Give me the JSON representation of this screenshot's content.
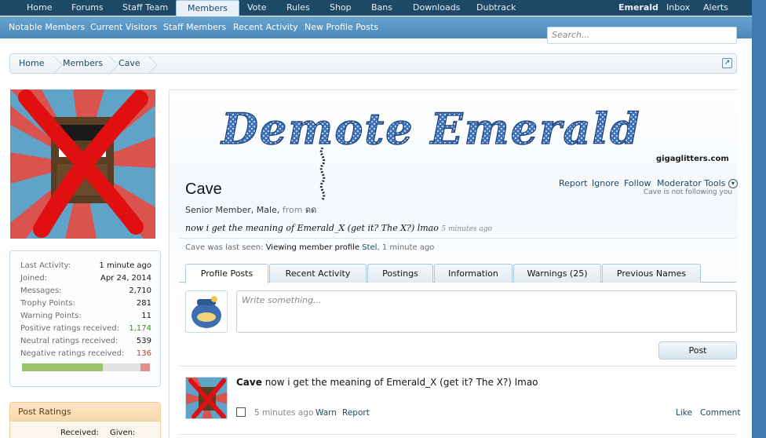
{
  "nav": {
    "items": [
      "Home",
      "Forums",
      "Staff Team",
      "Members",
      "Vote",
      "Rules",
      "Shop",
      "Bans",
      "Downloads",
      "Dubtrack"
    ],
    "active": "Members",
    "user": [
      "Emerald",
      "Inbox",
      "Alerts"
    ]
  },
  "subnav": [
    "Notable Members",
    "Current Visitors",
    "Staff Members",
    "Recent Activity",
    "New Profile Posts"
  ],
  "search": {
    "placeholder": "Search..."
  },
  "breadcrumb": [
    "Home",
    "Members",
    "Cave"
  ],
  "banner": {
    "text": "Demote Emerald",
    "credit": "gigaglitters.com"
  },
  "profile": {
    "name": "Cave",
    "meta_prefix": "Senior Member, Male, ",
    "from_label": "from",
    "from_value": "ดด",
    "status": "now i get the meaning of Emerald_X (get it? The X?) lmao",
    "status_ago": "5 minutes ago",
    "last_seen_prefix": "Cave was last seen:",
    "last_seen_action": "Viewing member profile",
    "last_seen_member": "Stel",
    "last_seen_time": ", 1 minute ago",
    "actions": [
      "Report",
      "Ignore",
      "Follow",
      "Moderator Tools"
    ],
    "follow_note": "Cave is not following you"
  },
  "stats": [
    {
      "k": "Last Activity:",
      "v": "1 minute ago",
      "color": "#141414"
    },
    {
      "k": "Joined:",
      "v": "Apr 24, 2014",
      "color": "#141414"
    },
    {
      "k": "Messages:",
      "v": "2,710",
      "color": "#141414"
    },
    {
      "k": "Trophy Points:",
      "v": "281",
      "color": "#141414"
    },
    {
      "k": "Warning Points:",
      "v": "11",
      "color": "#141414"
    },
    {
      "k": "Positive ratings received:",
      "v": "1,174",
      "color": "#3f8f1f"
    },
    {
      "k": "Neutral ratings received:",
      "v": "539",
      "color": "#141414"
    },
    {
      "k": "Negative ratings received:",
      "v": "136",
      "color": "#c0392b"
    }
  ],
  "ratings_bar": {
    "positive": 0.634,
    "neutral": 0.292,
    "negative": 0.074
  },
  "post_ratings": {
    "title": "Post Ratings",
    "received": "Received:",
    "given": "Given:"
  },
  "tabs": [
    "Profile Posts",
    "Recent Activity",
    "Postings",
    "Information",
    "Warnings (25)",
    "Previous Names"
  ],
  "active_tab": "Profile Posts",
  "composer": {
    "placeholder": "Write something...",
    "button": "Post"
  },
  "message": {
    "author": "Cave",
    "text": " now i get the meaning of Emerald_X (get it? The X?) lmao",
    "time": "5 minutes ago",
    "links": [
      "Warn",
      "Report"
    ],
    "right_links": [
      "Like",
      "Comment"
    ]
  },
  "colors": {
    "nav_bg": "#1d4866",
    "subnav_bg": "#4b89bb",
    "link": "#1d4866",
    "accent_orange": "#f8d9ad"
  }
}
